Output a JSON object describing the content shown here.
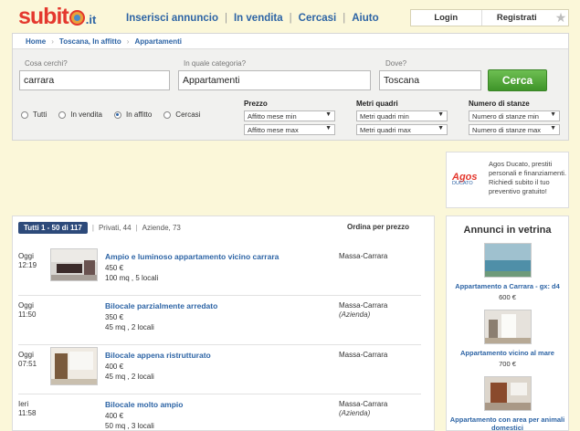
{
  "header": {
    "logo_word": "subit",
    "logo_tld": ".it",
    "nav": [
      "Inserisci annuncio",
      "In vendita",
      "Cercasi",
      "Aiuto"
    ],
    "login": "Login",
    "register": "Registrati"
  },
  "breadcrumb": [
    "Home",
    "Toscana, In affitto",
    "Appartamenti"
  ],
  "search": {
    "what_label": "Cosa cerchi?",
    "what_value": "carrara",
    "category_label": "In quale categoria?",
    "category_value": "Appartamenti",
    "where_label": "Dove?",
    "where_value": "Toscana",
    "button": "Cerca"
  },
  "filters": {
    "radios": [
      {
        "label": "Tutti",
        "selected": false
      },
      {
        "label": "In vendita",
        "selected": false
      },
      {
        "label": "In affitto",
        "selected": true
      },
      {
        "label": "Cercasi",
        "selected": false
      }
    ],
    "price": {
      "title": "Prezzo",
      "min": "Affitto mese min",
      "max": "Affitto mese max"
    },
    "size": {
      "title": "Metri quadri",
      "min": "Metri quadri min",
      "max": "Metri quadri max"
    },
    "rooms": {
      "title": "Numero di stanze",
      "min": "Numero di stanze min",
      "max": "Numero di stanze max"
    }
  },
  "ad": {
    "brand": "Agos",
    "brand_sub": "DUCATO",
    "text": "Agos Ducato, prestiti personali e finanziamenti. Richiedi subito il tuo preventivo gratuito!"
  },
  "listing": {
    "tab_all": "Tutti 1 - 50 di 117",
    "tab_private": "Privati, 44",
    "tab_company": "Aziende, 73",
    "order": "Ordina per prezzo",
    "rows": [
      {
        "day": "Oggi",
        "time": "12:19",
        "title": "Ampio e luminoso appartamento vicino carrara",
        "price": "450 €",
        "meta": "100 mq , 5 locali",
        "location": "Massa-Carrara",
        "tag": ""
      },
      {
        "day": "Oggi",
        "time": "11:50",
        "title": "Bilocale parzialmente arredato",
        "price": "350 €",
        "meta": "45 mq , 2 locali",
        "location": "Massa-Carrara",
        "tag": "(Azienda)"
      },
      {
        "day": "Oggi",
        "time": "07:51",
        "title": "Bilocale appena ristrutturato",
        "price": "400 €",
        "meta": "45 mq , 2 locali",
        "location": "Massa-Carrara",
        "tag": ""
      },
      {
        "day": "Ieri",
        "time": "11:58",
        "title": "Bilocale molto ampio",
        "price": "400 €",
        "meta": "50 mq , 3 locali",
        "location": "Massa-Carrara",
        "tag": "(Azienda)"
      }
    ]
  },
  "vetrina": {
    "title": "Annunci in vetrina",
    "items": [
      {
        "caption": "Appartamento a Carrara - gx: d4",
        "price": "600 €"
      },
      {
        "caption": "Appartamento vicino al mare",
        "price": "700 €"
      },
      {
        "caption": "Appartamento con area per animali domestici",
        "price": ""
      }
    ]
  }
}
